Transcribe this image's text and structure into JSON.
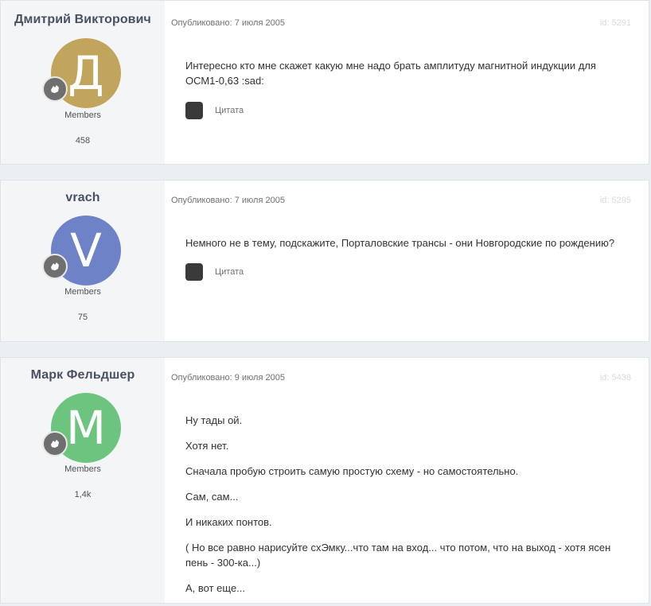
{
  "posts": [
    {
      "author": "Дмитрий Викторович",
      "avatar_letter": "Д",
      "avatar_color": "#c2a55d",
      "group": "Members",
      "post_count": "458",
      "published": "Опубликовано: 7 июля 2005",
      "post_id": "id: 5291",
      "paragraphs": [
        "Интересно кто мне скажет какую мне надо брать амплитуду магнитной индукции для ОСМ1-0,63 :sad:"
      ],
      "quote_label": "Цитата"
    },
    {
      "author": "vrach",
      "avatar_letter": "V",
      "avatar_color": "#6e82c7",
      "group": "Members",
      "post_count": "75",
      "published": "Опубликовано: 7 июля 2005",
      "post_id": "id: 5295",
      "paragraphs": [
        "Немного не в тему, подскажите, Порталовские трансы - они Новгородские по рождению?"
      ],
      "quote_label": "Цитата"
    },
    {
      "author": "Марк Фельдшер",
      "avatar_letter": "М",
      "avatar_color": "#6cc47f",
      "group": "Members",
      "post_count": "1,4k",
      "published": "Опубликовано: 9 июля 2005",
      "post_id": "id: 5438",
      "paragraphs": [
        "Ну тады ой.",
        "Хотя нет.",
        "Сначала пробую строить самую простую схему - но самостоятельно.",
        "Сам, сам...",
        "И никаких понтов.",
        "( Но все равно нарисуйте схЭмку...что там на вход... что потом, что на выход - хотя ясен пень - 300-ка...)",
        "А, вот еще..."
      ]
    }
  ]
}
